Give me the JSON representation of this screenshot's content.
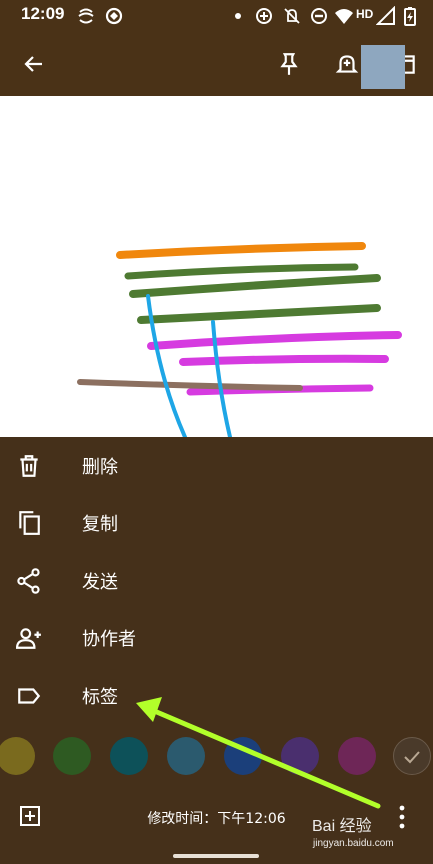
{
  "status_bar": {
    "time": "12:09",
    "network_label": "HD",
    "icons": [
      "swirl-icon",
      "sync-icon",
      "dot-icon",
      "data-saver-icon",
      "alarm-off-icon",
      "do-not-disturb-icon",
      "wifi-icon",
      "signal-icon",
      "battery-icon"
    ]
  },
  "app_bar": {
    "icons": [
      "back-arrow-icon",
      "pin-icon",
      "reminder-icon",
      "archive-icon"
    ]
  },
  "menu": {
    "items": [
      {
        "label": "删除",
        "icon": "trash-icon"
      },
      {
        "label": "复制",
        "icon": "copy-icon"
      },
      {
        "label": "发送",
        "icon": "share-icon"
      },
      {
        "label": "协作者",
        "icon": "add-person-icon"
      },
      {
        "label": "标签",
        "icon": "label-icon"
      }
    ]
  },
  "colors": {
    "swatches": [
      "#7a6a1e",
      "#2e5a22",
      "#0d5159",
      "#2b5a6e",
      "#1b3f7a",
      "#4a2f6e",
      "#6e2657",
      "#4a3a2a"
    ],
    "drawing": {
      "orange": "#f0870d",
      "green": "#4e7a32",
      "magenta": "#d63be0",
      "brown": "#8c7060",
      "blue": "#1ea6e6"
    },
    "annotation_arrow": "#b2ff2a"
  },
  "bottom_bar": {
    "modified_text": "修改时间：下午12:06"
  },
  "watermark": {
    "text": "Bai 经验",
    "sub": "jingyan.baidu.com"
  }
}
